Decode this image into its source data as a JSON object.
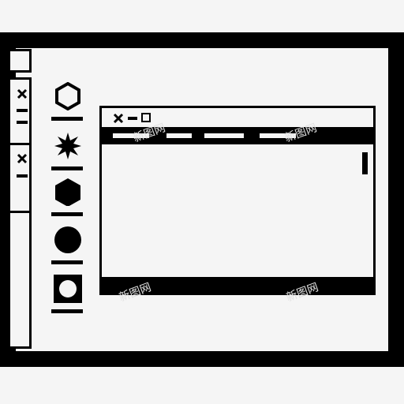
{
  "screen": {
    "name": "desktop-screen"
  },
  "side_panel": {
    "tabs": [
      {
        "icon": "close-icon"
      },
      {
        "icon": "close-icon"
      }
    ]
  },
  "toolbar": {
    "tools": [
      {
        "icon": "hexagon-outline-icon"
      },
      {
        "icon": "starburst-icon"
      },
      {
        "icon": "hexagon-filled-icon"
      },
      {
        "icon": "circle-filled-icon"
      },
      {
        "icon": "circle-in-square-icon"
      }
    ]
  },
  "window": {
    "controls": [
      "close-icon",
      "minimize-icon",
      "maximize-icon"
    ],
    "menu_items": 4
  },
  "watermark": "新图网",
  "colors": {
    "ink": "#000000",
    "paper": "#f5f5f5"
  }
}
